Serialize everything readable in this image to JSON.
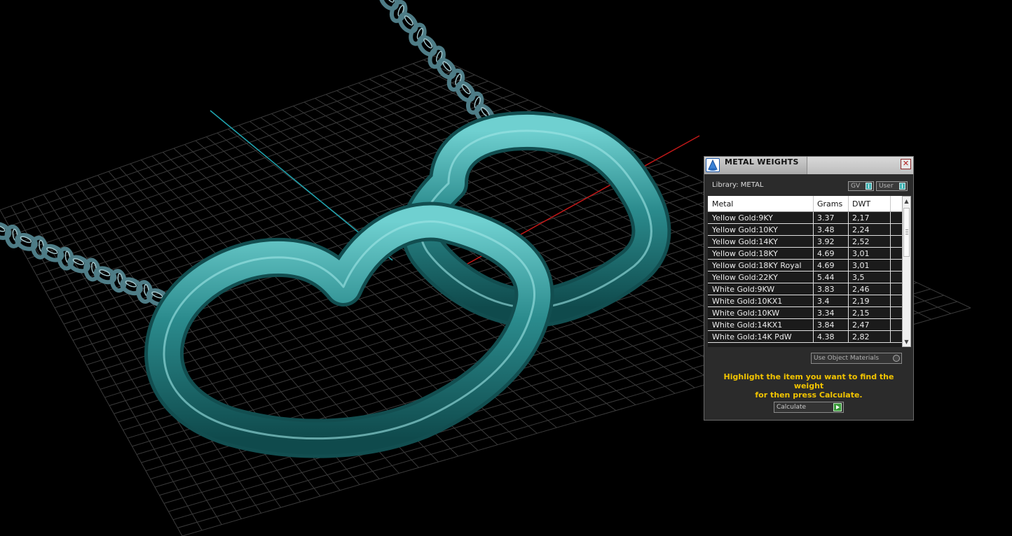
{
  "colors": {
    "background": "#000000",
    "grid": "#3a3a3a",
    "model": "#2f8f91",
    "chain": "#4e7c86",
    "axis_x": "#c01818",
    "axis_z": "#1fa5b0",
    "accent_text": "#f2c400"
  },
  "dialog": {
    "title": "METAL WEIGHTS",
    "close_label": "✕",
    "library_label": "Library: METAL",
    "toggle_gv": "GV",
    "toggle_user": "User",
    "columns": [
      "Metal",
      "Grams",
      "DWT"
    ],
    "rows": [
      {
        "metal": "Yellow Gold:9KY",
        "grams": "3.37",
        "dwt": "2,17"
      },
      {
        "metal": "Yellow Gold:10KY",
        "grams": "3.48",
        "dwt": "2,24"
      },
      {
        "metal": "Yellow Gold:14KY",
        "grams": "3.92",
        "dwt": "2,52"
      },
      {
        "metal": "Yellow Gold:18KY",
        "grams": "4.69",
        "dwt": "3,01"
      },
      {
        "metal": "Yellow Gold:18KY Royal",
        "grams": "4.69",
        "dwt": "3,01"
      },
      {
        "metal": "Yellow Gold:22KY",
        "grams": "5.44",
        "dwt": "3,5"
      },
      {
        "metal": "White Gold:9KW",
        "grams": "3.83",
        "dwt": "2,46"
      },
      {
        "metal": "White Gold:10KX1",
        "grams": "3.4",
        "dwt": "2,19"
      },
      {
        "metal": "White Gold:10KW",
        "grams": "3.34",
        "dwt": "2,15"
      },
      {
        "metal": "White Gold:14KX1",
        "grams": "3.84",
        "dwt": "2,47"
      },
      {
        "metal": "White Gold:14K PdW",
        "grams": "4.38",
        "dwt": "2,82"
      }
    ],
    "use_object_materials_label": "Use Object Materials",
    "hint_line1": "Highlight the item you want to find the weight",
    "hint_line2": "for then press Calculate.",
    "calculate_label": "Calculate"
  }
}
